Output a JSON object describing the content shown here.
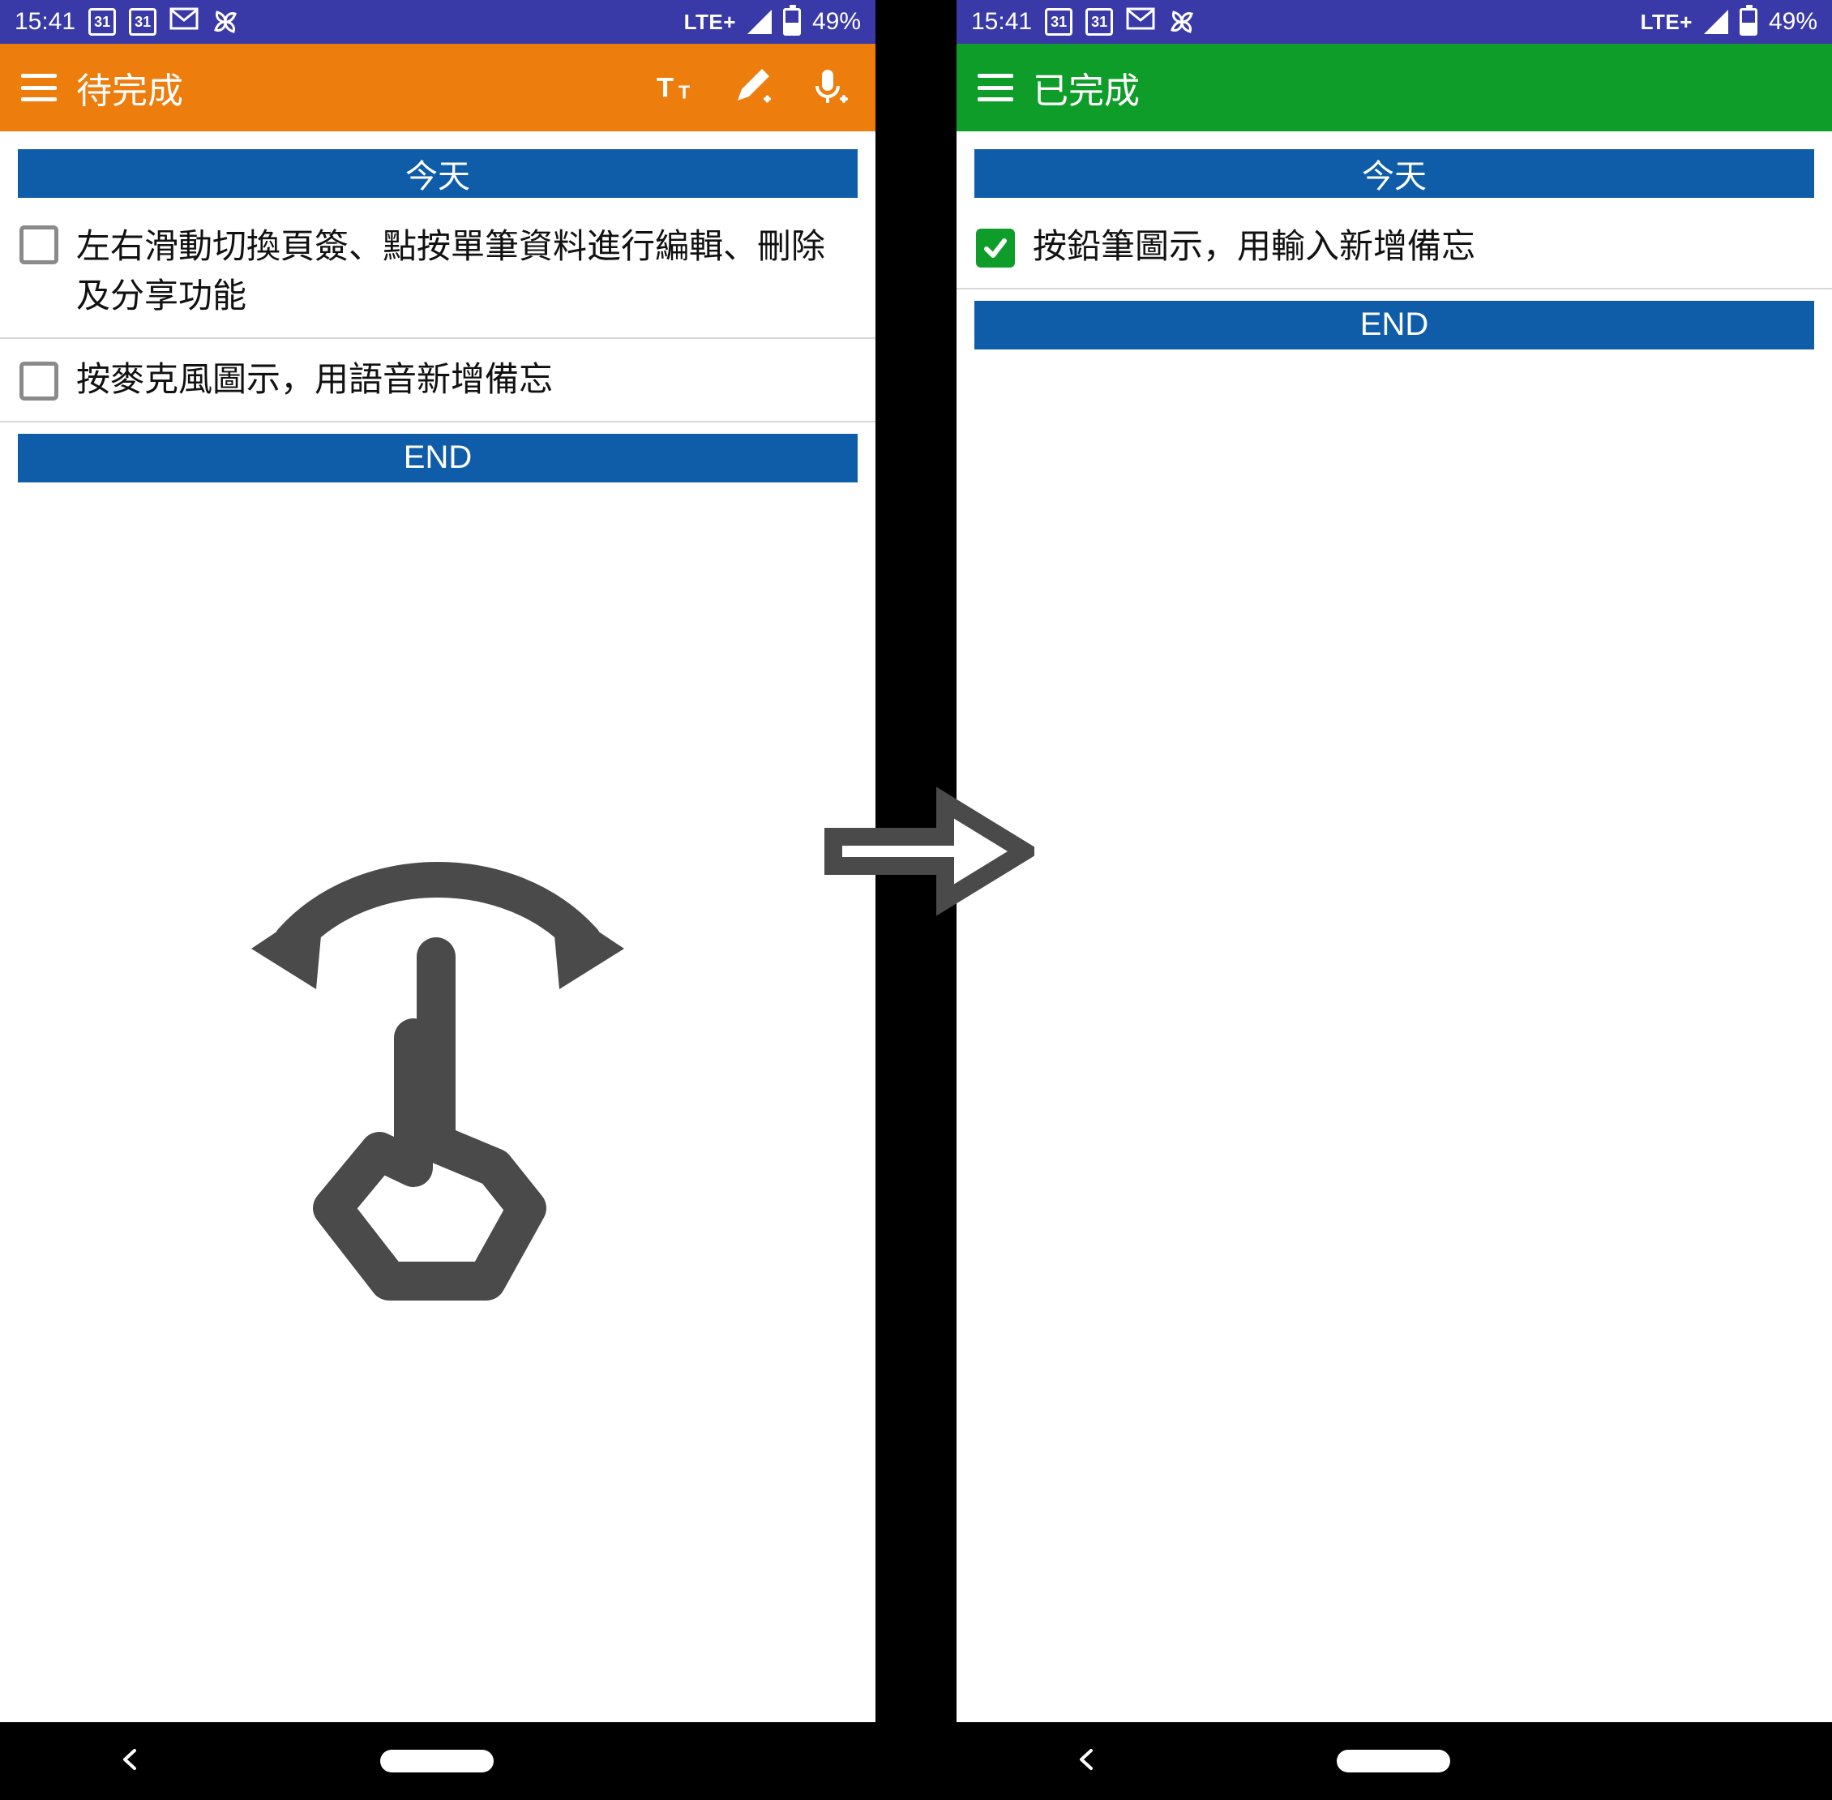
{
  "status": {
    "time": "15:41",
    "calendar_day": "31",
    "network_label": "LTE+",
    "battery_percent": "49%"
  },
  "left": {
    "title": "待完成",
    "section_today": "今天",
    "items": [
      {
        "text": "左右滑動切換頁簽、點按單筆資料進行編輯、刪除及分享功能",
        "checked": false
      },
      {
        "text": "按麥克風圖示，用語音新增備忘",
        "checked": false
      }
    ],
    "end_label": "END"
  },
  "right": {
    "title": "已完成",
    "section_today": "今天",
    "items": [
      {
        "text": "按鉛筆圖示，用輸入新增備忘",
        "checked": true
      }
    ],
    "end_label": "END"
  }
}
